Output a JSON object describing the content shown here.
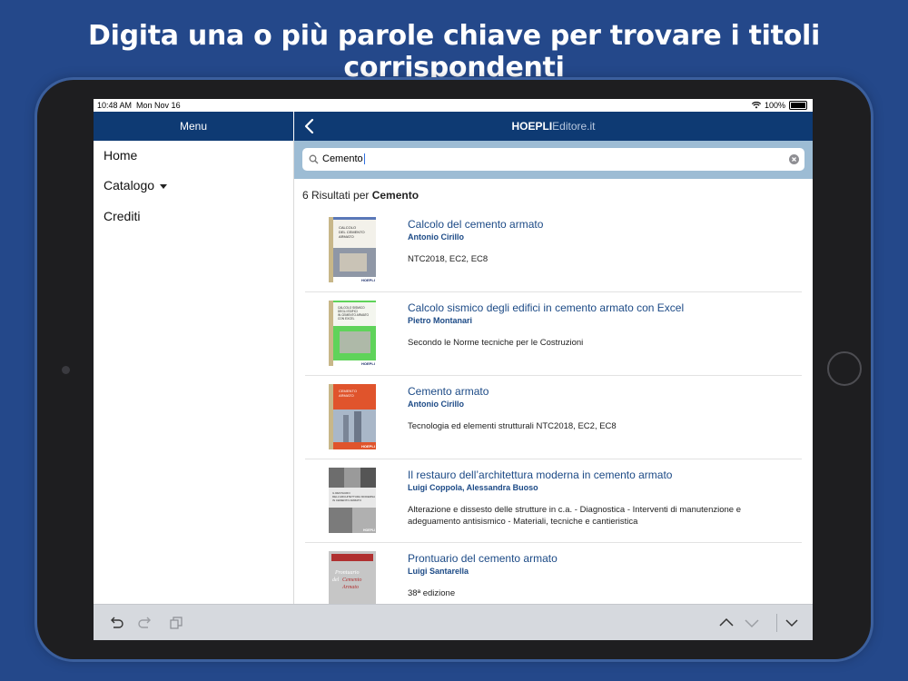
{
  "headline": "Digita una o più parole chiave per trovare i titoli corrispondenti",
  "status_bar": {
    "time": "10:48 AM",
    "date": "Mon Nov 16",
    "battery": "100%"
  },
  "sidebar": {
    "title": "Menu",
    "items": [
      {
        "label": "Home",
        "has_dropdown": false
      },
      {
        "label": "Catalogo",
        "has_dropdown": true
      },
      {
        "label": "Crediti",
        "has_dropdown": false
      }
    ]
  },
  "navbar": {
    "brand_bold": "HOEPLI",
    "brand_light": "Editore.it",
    "back_icon": "chevron-left-icon"
  },
  "search": {
    "value": "Cemento",
    "search_icon": "magnifier-icon",
    "clear_icon": "clear-circle-icon"
  },
  "results_summary": {
    "prefix": "6 Risultati per",
    "query": "Cemento"
  },
  "results": [
    {
      "title": "Calcolo del cemento armato",
      "author": "Antonio Cirillo",
      "description": "NTC2018, EC2, EC8",
      "cover_text": "CALCOLO DEL CEMENTO ARMATO",
      "cover_color": "#5a78b8",
      "cover_publisher": "HOEPLI"
    },
    {
      "title": "Calcolo sismico degli edifici in cemento armato con Excel",
      "author": "Pietro Montanari",
      "description": "Secondo le Norme tecniche per le Costruzioni",
      "cover_text": "CALCOLO SISMICO DEGLI EDIFICI IN CEMENTO ARMATO CON EXCEL",
      "cover_color": "#43c24a",
      "cover_publisher": "HOEPLI"
    },
    {
      "title": "Cemento armato",
      "author": "Antonio Cirillo",
      "description": "Tecnologia ed elementi strutturali NTC2018, EC2, EC8",
      "cover_text": "CEMENTO ARMATO",
      "cover_color": "#e0542c",
      "cover_publisher": "HOEPLI"
    },
    {
      "title": "Il restauro dell’architettura moderna in cemento armato",
      "author": "Luigi Coppola, Alessandra Buoso",
      "description": "Alterazione e dissesto delle strutture in c.a. - Diagnostica - Interventi di manutenzione e adeguamento antisismico - Materiali, tecniche e cantieristica",
      "cover_text": "IL RESTAURO DELL’ARCHITETTURA MODERNA IN CEMENTO ARMATO",
      "cover_color": "#8a8a8a",
      "cover_publisher": "HOEPLI"
    },
    {
      "title": "Prontuario del cemento armato",
      "author": "Luigi Santarella",
      "description": "38ª edizione",
      "cover_text": "Prontuario del Cemento Armato",
      "cover_color": "#b03030",
      "cover_publisher": "HOEPLI"
    }
  ],
  "toolbar": {
    "undo_icon": "undo-icon",
    "redo_icon": "redo-icon",
    "copy_icon": "copy-icon",
    "up_icon": "chevron-up-icon",
    "down_icon": "chevron-down-icon",
    "hide_icon": "keyboard-hide-icon"
  },
  "colors": {
    "background": "#24488a",
    "navbar": "#0e3a73",
    "searchbar": "#9dbcd4",
    "link": "#1c4a86",
    "toolbar": "#d6d9de"
  }
}
